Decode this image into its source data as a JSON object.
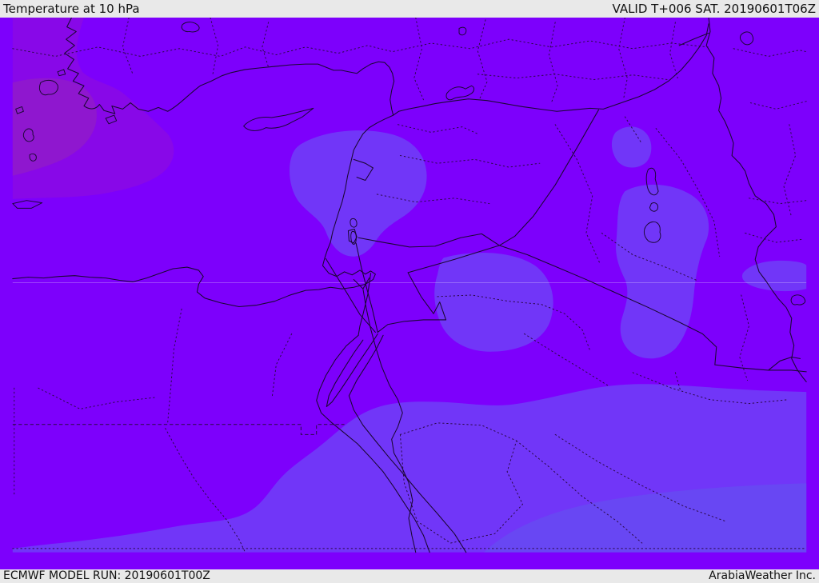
{
  "header": {
    "title": "Temperature at 10 hPa",
    "valid_label": "VALID T+006 SAT. 20190601T06Z"
  },
  "footer": {
    "model_run_label": "ECMWF MODEL RUN: 20190601T00Z",
    "credit_label": "ArabiaWeather Inc."
  },
  "map": {
    "colors": {
      "base": "#7D00FC",
      "band_dark_outer": "#8808E8",
      "band_dark_inner": "#8F17CF",
      "band_light": "#7136F8",
      "band_light_2": "#6847F3",
      "chrome_bg": "#E9E9E9",
      "chrome_text": "#111111",
      "line_solid": "#1B0733",
      "line_dotted": "#2A0845",
      "graticule": "rgba(255,255,255,0.30)"
    }
  }
}
